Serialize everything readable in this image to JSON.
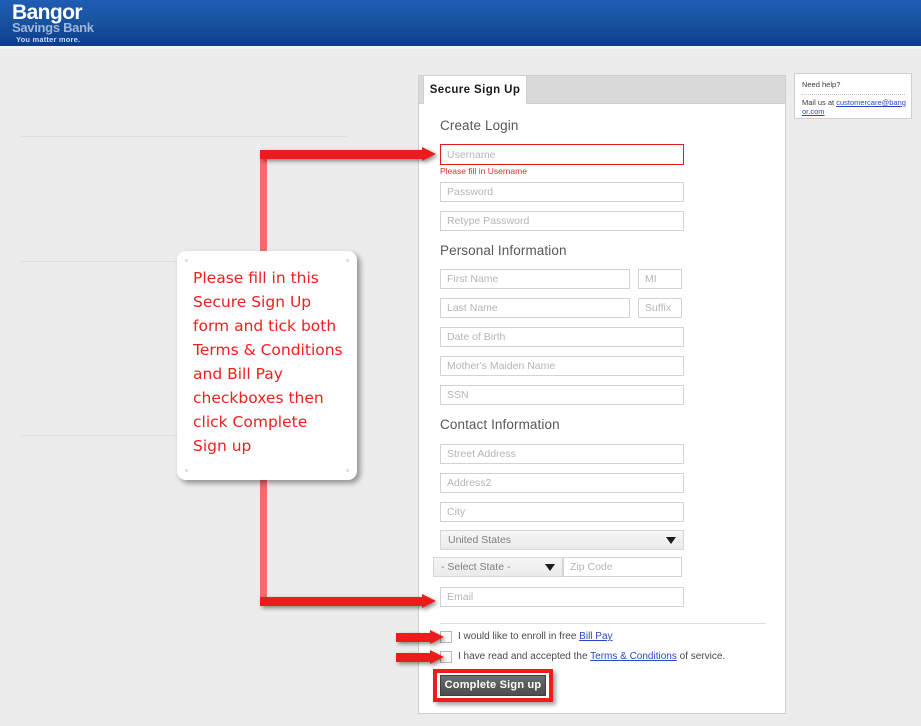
{
  "header": {
    "brand_line1": "Bangor",
    "brand_line2": "Savings Bank",
    "tagline": "You  matter more.",
    "brand_blue": "#18549f"
  },
  "signup_panel": {
    "tab_label": "Secure Sign Up",
    "sections": {
      "create_login": "Create Login",
      "personal_information": "Personal Information",
      "contact_information": "Contact Information"
    },
    "fields": {
      "username": {
        "placeholder": "Username",
        "value": "",
        "error": "Please fill in Username"
      },
      "password": {
        "placeholder": "Password",
        "value": ""
      },
      "retype_password": {
        "placeholder": "Retype Password",
        "value": ""
      },
      "first_name": {
        "placeholder": "First Name",
        "value": ""
      },
      "mi": {
        "placeholder": "MI",
        "value": ""
      },
      "last_name": {
        "placeholder": "Last Name",
        "value": ""
      },
      "suffix": {
        "placeholder": "Suffix",
        "value": ""
      },
      "date_of_birth": {
        "placeholder": "Date of Birth",
        "value": ""
      },
      "mothers_maiden_name": {
        "placeholder": "Mother's Maiden Name",
        "value": ""
      },
      "ssn": {
        "placeholder": "SSN",
        "value": ""
      },
      "street_address": {
        "placeholder": "Street Address",
        "value": ""
      },
      "address2": {
        "placeholder": "Address2",
        "value": ""
      },
      "city": {
        "placeholder": "City",
        "value": ""
      },
      "zip_code": {
        "placeholder": "Zip Code",
        "value": ""
      },
      "email": {
        "placeholder": "Email",
        "value": ""
      }
    },
    "selects": {
      "country": {
        "selected": "United States"
      },
      "state": {
        "selected": "- Select State -"
      }
    },
    "checkboxes": {
      "bill_pay": {
        "checked": false,
        "text_before": "I would like to enroll in free ",
        "link": "Bill Pay",
        "text_after": ""
      },
      "terms": {
        "checked": false,
        "text_before": "I have read and accepted the ",
        "link": "Terms & Conditions",
        "text_after": " of service."
      }
    },
    "submit_label": "Complete Sign up"
  },
  "help_panel": {
    "title": "Need help?",
    "text_before": "Mail us at ",
    "email_link": "customercare@bangor.com"
  },
  "annotation": {
    "callout_text": "Please fill in this Secure Sign Up form and tick both Terms & Conditions and Bill Pay checkboxes then click Complete Sign up",
    "accent_color": "#ed1c1c"
  }
}
